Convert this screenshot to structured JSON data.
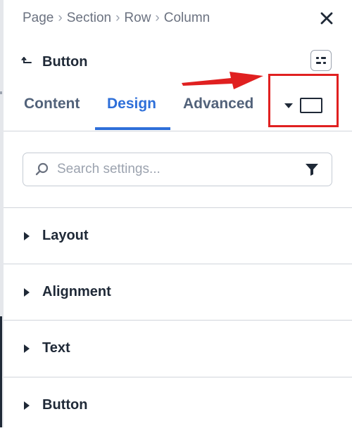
{
  "breadcrumb": {
    "items": [
      "Page",
      "Section",
      "Row",
      "Column"
    ],
    "separator": "›"
  },
  "header": {
    "title": "Button"
  },
  "tabs": [
    {
      "label": "Content",
      "active": false
    },
    {
      "label": "Design",
      "active": true
    },
    {
      "label": "Advanced",
      "active": false
    }
  ],
  "search": {
    "placeholder": "Search settings...",
    "value": ""
  },
  "sections": [
    {
      "label": "Layout"
    },
    {
      "label": "Alignment"
    },
    {
      "label": "Text"
    },
    {
      "label": "Button"
    }
  ],
  "colors": {
    "accent": "#2e6fd9",
    "highlight": "#e02020",
    "text": "#1f2937",
    "muted": "#6b7280"
  },
  "icons": {
    "close": "close-icon",
    "back": "back-arrow-icon",
    "panel_toggle": "panel-toggle-icon",
    "device": "laptop-icon",
    "device_dropdown": "caret-down-icon",
    "search": "search-icon",
    "filter": "filter-icon",
    "section_expand": "triangle-right-icon"
  }
}
